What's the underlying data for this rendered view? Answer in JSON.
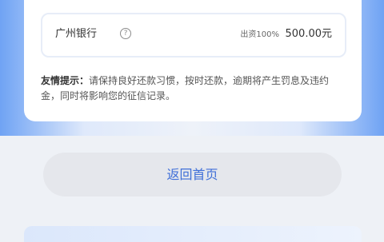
{
  "loan_detail": {
    "funder": {
      "name": "广州银行",
      "ratio": "出资100%",
      "amount": "500.00元"
    },
    "tip": {
      "label": "友情提示：",
      "text": "请保持良好还款习惯，按时还款，逾期将产生罚息及违约金，同时将影响您的征信记录。"
    }
  },
  "actions": {
    "home_label": "返回首页"
  }
}
